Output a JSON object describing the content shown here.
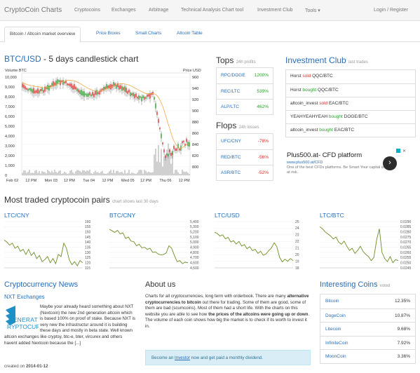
{
  "navbar": {
    "brand": "CryptoCoin Charts",
    "items": [
      "Cryptocoins",
      "Exchanges",
      "Arbitrage",
      "Technical Analysis Chart tool",
      "Investment Club",
      "Tools ▾"
    ],
    "right": "Login / Register"
  },
  "tabs": [
    "Bitcoin / Altcoin market overview",
    "Price Boxes",
    "Small Charts",
    "Altcoin Table"
  ],
  "main_chart": {
    "title_link": "BTC/USD",
    "title_rest": " - 5 days candlestick chart",
    "left_label": "Volume BTC",
    "right_label": "Price USD",
    "left_ticks": [
      "10,000",
      "9,000",
      "8,000",
      "7,000",
      "6,000",
      "5,000",
      "4,000",
      "3,000",
      "2,000",
      "1,000",
      "0"
    ],
    "right_ticks": [
      "960",
      "940",
      "920",
      "900",
      "880",
      "860",
      "840",
      "820",
      "800"
    ],
    "x_ticks": [
      "Feb 02",
      "12 PM",
      "Mon 03",
      "12 PM",
      "Tue 04",
      "12 PM",
      "Wed 05",
      "12 PM",
      "Thu 06",
      "12 PM"
    ]
  },
  "tops": {
    "title": "Tops",
    "subtitle": "24h profits",
    "rows": [
      {
        "pair": "RPC/DOGE",
        "pct": "1200%"
      },
      {
        "pair": "REC/LTC",
        "pct": "539%"
      },
      {
        "pair": "ALP/LTC",
        "pct": "462%"
      }
    ]
  },
  "flops": {
    "title": "Flops",
    "subtitle": "24h losses",
    "rows": [
      {
        "pair": "UFC/CNY",
        "pct": "-78%"
      },
      {
        "pair": "RED/BTC",
        "pct": "-56%"
      },
      {
        "pair": "ASR/BTC",
        "pct": "-52%"
      }
    ]
  },
  "investment_club": {
    "title": "Investment Club",
    "subtitle": "last trades",
    "trades": [
      {
        "user": "Horst",
        "action": "sold",
        "pair": "QQC/BTC"
      },
      {
        "user": "Horst",
        "action": "bought",
        "pair": "QQC/BTC"
      },
      {
        "user": "altcoin_invest",
        "action": "sold",
        "pair": "EAC/BTC"
      },
      {
        "user": "YEAHYEAHYEAH",
        "action": "bought",
        "pair": "DOGE/BTC"
      },
      {
        "user": "altcoin_invest",
        "action": "bought",
        "pair": "EAC/BTC"
      }
    ]
  },
  "ad": {
    "headline": "Plus500.at- CFD platform",
    "url": "www.plus500.at/CFD",
    "text": "One of the best CFDs platforms. Be Smart Your capital is at risk."
  },
  "most_traded": {
    "title": "Most traded cryptocoin pairs",
    "subtitle": "chart shows last 30 days",
    "charts": [
      {
        "label": "LTC/CNY",
        "ticks": [
          "160",
          "155",
          "150",
          "145",
          "140",
          "135",
          "130",
          "125",
          "120",
          "115"
        ],
        "values": [
          142,
          140,
          137,
          139,
          134,
          136,
          131,
          133,
          128,
          133,
          127,
          130,
          124,
          127,
          121,
          123,
          126,
          120,
          124,
          119,
          128,
          126,
          139,
          134,
          123,
          118,
          121,
          117,
          122,
          120
        ]
      },
      {
        "label": "BTC/CNY",
        "ticks": [
          "5,400",
          "5,300",
          "5,200",
          "5,100",
          "5,000",
          "4,900",
          "4,800",
          "4,700",
          "4,600",
          "4,500"
        ],
        "values": [
          5250,
          5220,
          5190,
          5230,
          5160,
          5180,
          5070,
          5100,
          5020,
          5010,
          4930,
          4960,
          4890,
          4900,
          4860,
          4880,
          4800,
          4810,
          4770,
          4750,
          4760,
          4790,
          4930,
          4880,
          4740,
          4620,
          4640,
          4580,
          4610,
          4600
        ]
      },
      {
        "label": "LTC/USD",
        "ticks": [
          "25",
          "24",
          "23",
          "22",
          "21",
          "20",
          "19",
          "18"
        ],
        "values": [
          23.4,
          23.2,
          22.8,
          23.0,
          22.4,
          22.6,
          21.9,
          22.1,
          21.6,
          22.0,
          21.3,
          21.5,
          20.9,
          21.2,
          20.6,
          20.8,
          20.2,
          20.5,
          19.9,
          20.1,
          20.6,
          21.0,
          21.8,
          21.2,
          19.6,
          18.9,
          19.3,
          19.0,
          19.4,
          19.1
        ]
      },
      {
        "label": "LTC/BTC",
        "ticks": [
          "0.0290",
          "0.0285",
          "0.0280",
          "0.0275",
          "0.0270",
          "0.0265",
          "0.0260",
          "0.0255",
          "0.0250",
          "0.0245"
        ],
        "values": [
          0.0285,
          0.0283,
          0.028,
          0.0278,
          0.0276,
          0.0273,
          0.0275,
          0.027,
          0.0268,
          0.0271,
          0.0266,
          0.0262,
          0.0264,
          0.0259,
          0.0262,
          0.0266,
          0.0261,
          0.0258,
          0.0256,
          0.0252,
          0.0255,
          0.0272,
          0.0283,
          0.026,
          0.0254,
          0.0251,
          0.0256,
          0.025,
          0.0253,
          0.0252
        ]
      }
    ]
  },
  "news": {
    "title": "Cryptocurrency News",
    "item_title": "NXT Exchanges",
    "logo_line1": "GENERAT",
    "logo_line2": "RYPTOCURR",
    "body": "Maybe your already heard something about NXT (Nextcoin) the new 2nd generation altcoin which is based 100% on proof of stake. Because NXT is very new the infrastructur around it is building these days and mostly in beta state. Well known altcoin exchanges like cryptsy, btc-e, bter, vircurex and others havent added Nextcoin because the [...]",
    "date_prefix": "created on ",
    "date": "2014-01-12"
  },
  "about": {
    "title": "About us",
    "p1": "Charts for all cryptocurrencies, long term with orderbook. There are many ",
    "p1_bold": "alternative cryptocurrencies to bitcoin",
    "p2": " out there for trading. Some of them are good, some of them are bad (scumcoins). Most of them had a short life. With the charts on this website you are able to see how ",
    "p2_bold": "the prices of the altcoins were going up or down",
    "p3": ". The volume of each coin shows how big the market is to check if its worth to invest it in.",
    "callout_a": "Become an ",
    "callout_link": "Investor",
    "callout_b": " now and get paid a monthly dividend."
  },
  "interesting_coins": {
    "title": "Interesting Coins",
    "subtitle": "voted",
    "rows": [
      {
        "name": "Bitcoin",
        "value": "12.35%"
      },
      {
        "name": "DogeCoin",
        "value": "10.87%"
      },
      {
        "name": "Litecoin",
        "value": "9.68%"
      },
      {
        "name": "InfiniteCoin",
        "value": "7.92%"
      },
      {
        "name": "MoonCoin",
        "value": "3.36%"
      }
    ]
  },
  "colors": {
    "accent": "#2a6db5",
    "up": "#2e9c2e",
    "down": "#d9302c",
    "line": "#6b8e23"
  }
}
